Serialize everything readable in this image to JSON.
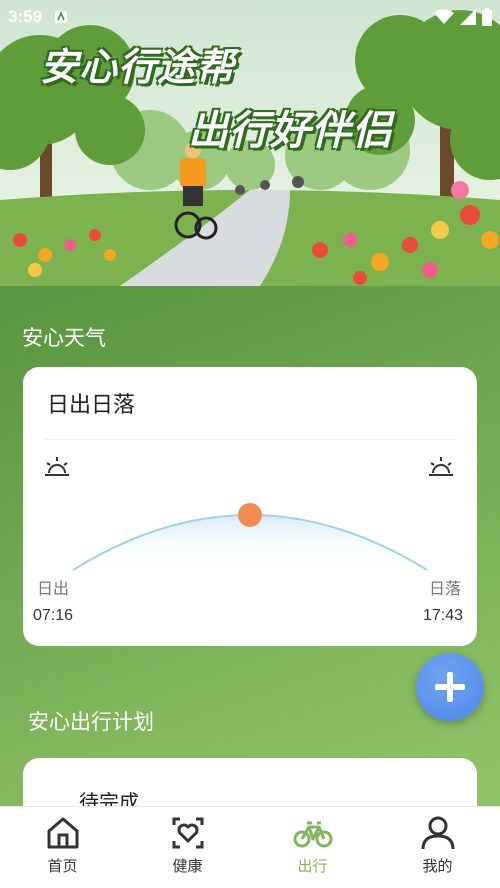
{
  "status_bar": {
    "time": "3:59"
  },
  "banner": {
    "title_line1": "安心行途帮",
    "title_line2": "出行好伴侣"
  },
  "weather_section": {
    "title": "安心天气"
  },
  "sun_card": {
    "title": "日出日落",
    "sunrise_label": "日出",
    "sunset_label": "日落",
    "sunrise_time": "07:16",
    "sunset_time": "17:43",
    "sun_progress": 0.5
  },
  "plan_section": {
    "title": "安心出行计划",
    "status": "待完成"
  },
  "nav": {
    "items": [
      {
        "label": "首页",
        "icon": "home-icon",
        "active": false
      },
      {
        "label": "健康",
        "icon": "health-icon",
        "active": false
      },
      {
        "label": "出行",
        "icon": "bike-icon",
        "active": true
      },
      {
        "label": "我的",
        "icon": "profile-icon",
        "active": false
      }
    ]
  },
  "colors": {
    "accent_green": "#7fb55b",
    "fab_blue": "#4f86e8",
    "sun_orange": "#f28c54"
  }
}
